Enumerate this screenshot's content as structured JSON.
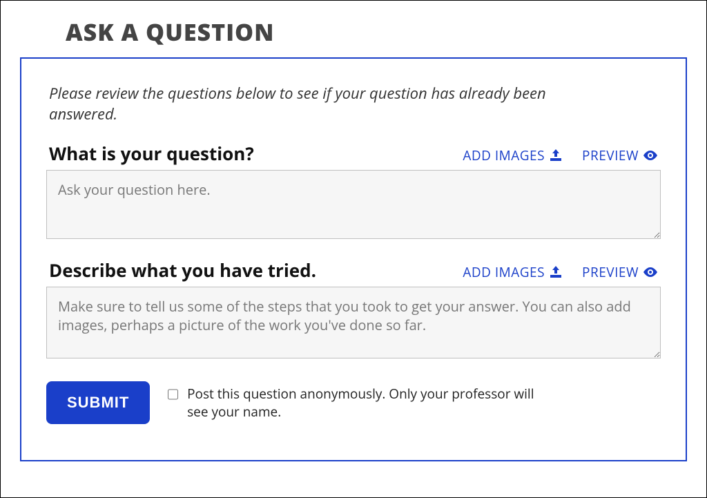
{
  "title": "ASK A QUESTION",
  "intro": "Please review the questions below to see if your question has already been answered.",
  "actions": {
    "add_images": "ADD IMAGES",
    "preview": "PREVIEW"
  },
  "sections": {
    "question": {
      "label": "What is your question?",
      "placeholder": "Ask your question here.",
      "value": ""
    },
    "tried": {
      "label": "Describe what you have tried.",
      "placeholder": "Make sure to tell us some of the steps that you took to get your answer. You can also add images, perhaps a picture of the work you've done so far.",
      "value": ""
    }
  },
  "footer": {
    "submit": "SUBMIT",
    "anonymous_label": "Post this question anonymously. Only your professor will see your name.",
    "anonymous_checked": false
  },
  "colors": {
    "accent": "#1a3fc9"
  }
}
